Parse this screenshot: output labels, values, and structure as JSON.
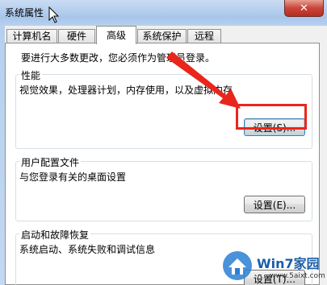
{
  "window": {
    "title": "系统属性",
    "close_label": "✕"
  },
  "tabs": [
    {
      "label": "计算机名"
    },
    {
      "label": "硬件"
    },
    {
      "label": "高级",
      "active": true
    },
    {
      "label": "系统保护"
    },
    {
      "label": "远程"
    }
  ],
  "admin_note": "要进行大多数更改，您必须作为管理员登录。",
  "performance": {
    "label": "性能",
    "description": "视觉效果，处理器计划，内存使用，以及虚拟内存",
    "button": "设置(S)..."
  },
  "user_profiles": {
    "label": "用户配置文件",
    "description": "与您登录有关的桌面设置",
    "button": "设置(E)..."
  },
  "startup_recovery": {
    "label": "启动和故障恢复",
    "description": "系统启动、系统失败和调试信息",
    "button": "设置(T)..."
  },
  "watermark": {
    "brand": "Win7家园",
    "url": "www.5aixt.com"
  },
  "colors": {
    "annotation": "#e8261d",
    "title_bg": "#b7d0ee"
  }
}
